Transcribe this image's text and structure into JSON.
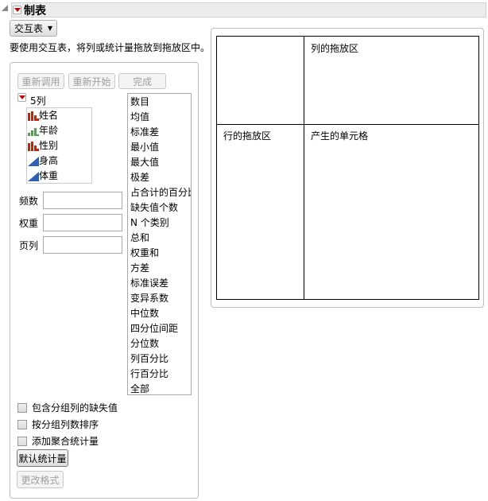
{
  "header": {
    "title": "制表"
  },
  "mode_select": {
    "value": "交互表"
  },
  "instruction": "要使用交互表，将列或统计量拖放到拖放区中。",
  "buttons": {
    "recall": "重新调用",
    "restart": "重新开始",
    "done": "完成",
    "default_stats": "默认统计量",
    "change_format": "更改格式"
  },
  "columns": {
    "label": "5列",
    "items": [
      {
        "name": "姓名",
        "type": "nominal",
        "color": "#cc2200"
      },
      {
        "name": "年龄",
        "type": "ordinal",
        "color": "#44aa44"
      },
      {
        "name": "性别",
        "type": "nominal",
        "color": "#cc2200"
      },
      {
        "name": "身高",
        "type": "continuous",
        "color": "#2f5fb8"
      },
      {
        "name": "体重",
        "type": "continuous",
        "color": "#2f5fb8"
      }
    ]
  },
  "roles": [
    {
      "label": "频数",
      "value": ""
    },
    {
      "label": "权重",
      "value": ""
    },
    {
      "label": "页列",
      "value": ""
    }
  ],
  "statistics": [
    "数目",
    "均值",
    "标准差",
    "最小值",
    "最大值",
    "极差",
    "占合计的百分比",
    "缺失值个数",
    "N 个类别",
    "总和",
    "权重和",
    "方差",
    "标准误差",
    "变异系数",
    "中位数",
    "四分位间距",
    "分位数",
    "列百分比",
    "行百分比",
    "全部"
  ],
  "options": [
    {
      "label": "包含分组列的缺失值",
      "checked": false
    },
    {
      "label": "按分组列数排序",
      "checked": false
    },
    {
      "label": "添加聚合统计量",
      "checked": false
    }
  ],
  "drop_zones": {
    "column": "列的拖放区",
    "row": "行的拖放区",
    "cells": "产生的单元格"
  }
}
